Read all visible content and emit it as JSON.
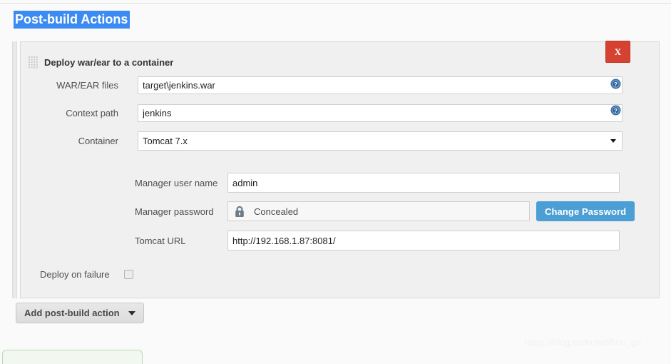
{
  "page": {
    "section_title": "Post-build Actions",
    "watermark": "https://blog.csdn.net/hou_ge"
  },
  "colors": {
    "title_highlight": "#3b8bf3",
    "delete_button": "#d64232",
    "primary_button": "#4b9fd5",
    "panel_bg": "#f0f0f0",
    "page_bg": "#fafafa",
    "help_icon": "#3a6ea5",
    "green_panel_bg": "#f2f7ef",
    "green_panel_border": "#bcd7bc"
  },
  "panel": {
    "header_label": "Deploy war/ear to a container",
    "grip_icon": "drag-handle-icon",
    "close_label": "X",
    "close_icon": "close-icon"
  },
  "fields": {
    "war_ear": {
      "label": "WAR/EAR files",
      "value": "target\\jenkins.war",
      "placeholder": "",
      "help_icon": "help-circle-icon"
    },
    "context_path": {
      "label": "Context path",
      "value": "jenkins",
      "placeholder": "",
      "help_icon": "help-circle-icon"
    },
    "container": {
      "label": "Container",
      "value": "Tomcat 7.x",
      "options": [
        "Tomcat 7.x"
      ],
      "arrow_icon": "chevron-down-icon"
    },
    "manager_user": {
      "label": "Manager user name",
      "value": "admin",
      "placeholder": ""
    },
    "manager_password": {
      "label": "Manager password",
      "value": "Concealed",
      "lock_icon": "lock-icon",
      "change_button": "Change Password"
    },
    "tomcat_url": {
      "label": "Tomcat URL",
      "value": "http://192.168.1.87:8081/",
      "placeholder": ""
    },
    "deploy_on_failure": {
      "label": "Deploy on failure",
      "checked": false
    }
  },
  "actions": {
    "add_post_build": "Add post-build action",
    "add_caret_icon": "caret-down-icon"
  }
}
